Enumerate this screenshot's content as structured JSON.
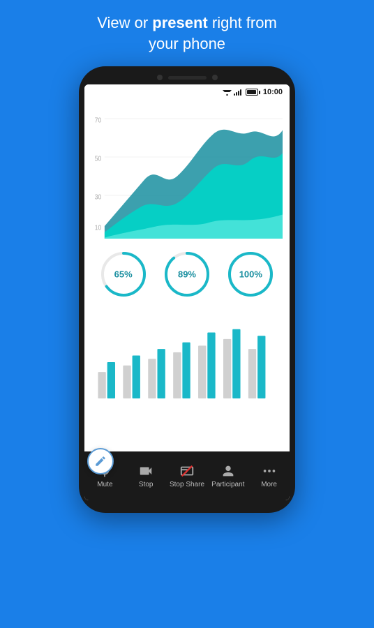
{
  "header": {
    "line1": "View or ",
    "bold": "present",
    "line1_suffix": " right from",
    "line2": "your phone"
  },
  "status_bar": {
    "time": "10:00"
  },
  "circles": [
    {
      "id": "c1",
      "value": 65,
      "label": "65%",
      "color": "#1ab8c8",
      "bg": "#e0e0e0"
    },
    {
      "id": "c2",
      "value": 89,
      "label": "89%",
      "color": "#1ab8c8",
      "bg": "#e0e0e0"
    },
    {
      "id": "c3",
      "value": 100,
      "label": "100%",
      "color": "#1ab8c8",
      "bg": "#e0e0e0"
    }
  ],
  "nav_items": [
    {
      "id": "mute",
      "label": "Mute",
      "icon": "mic"
    },
    {
      "id": "stop",
      "label": "Stop",
      "icon": "video"
    },
    {
      "id": "stop_share",
      "label": "Stop Share",
      "icon": "share"
    },
    {
      "id": "participant",
      "label": "Participant",
      "icon": "person"
    },
    {
      "id": "more",
      "label": "More",
      "icon": "dots"
    }
  ]
}
